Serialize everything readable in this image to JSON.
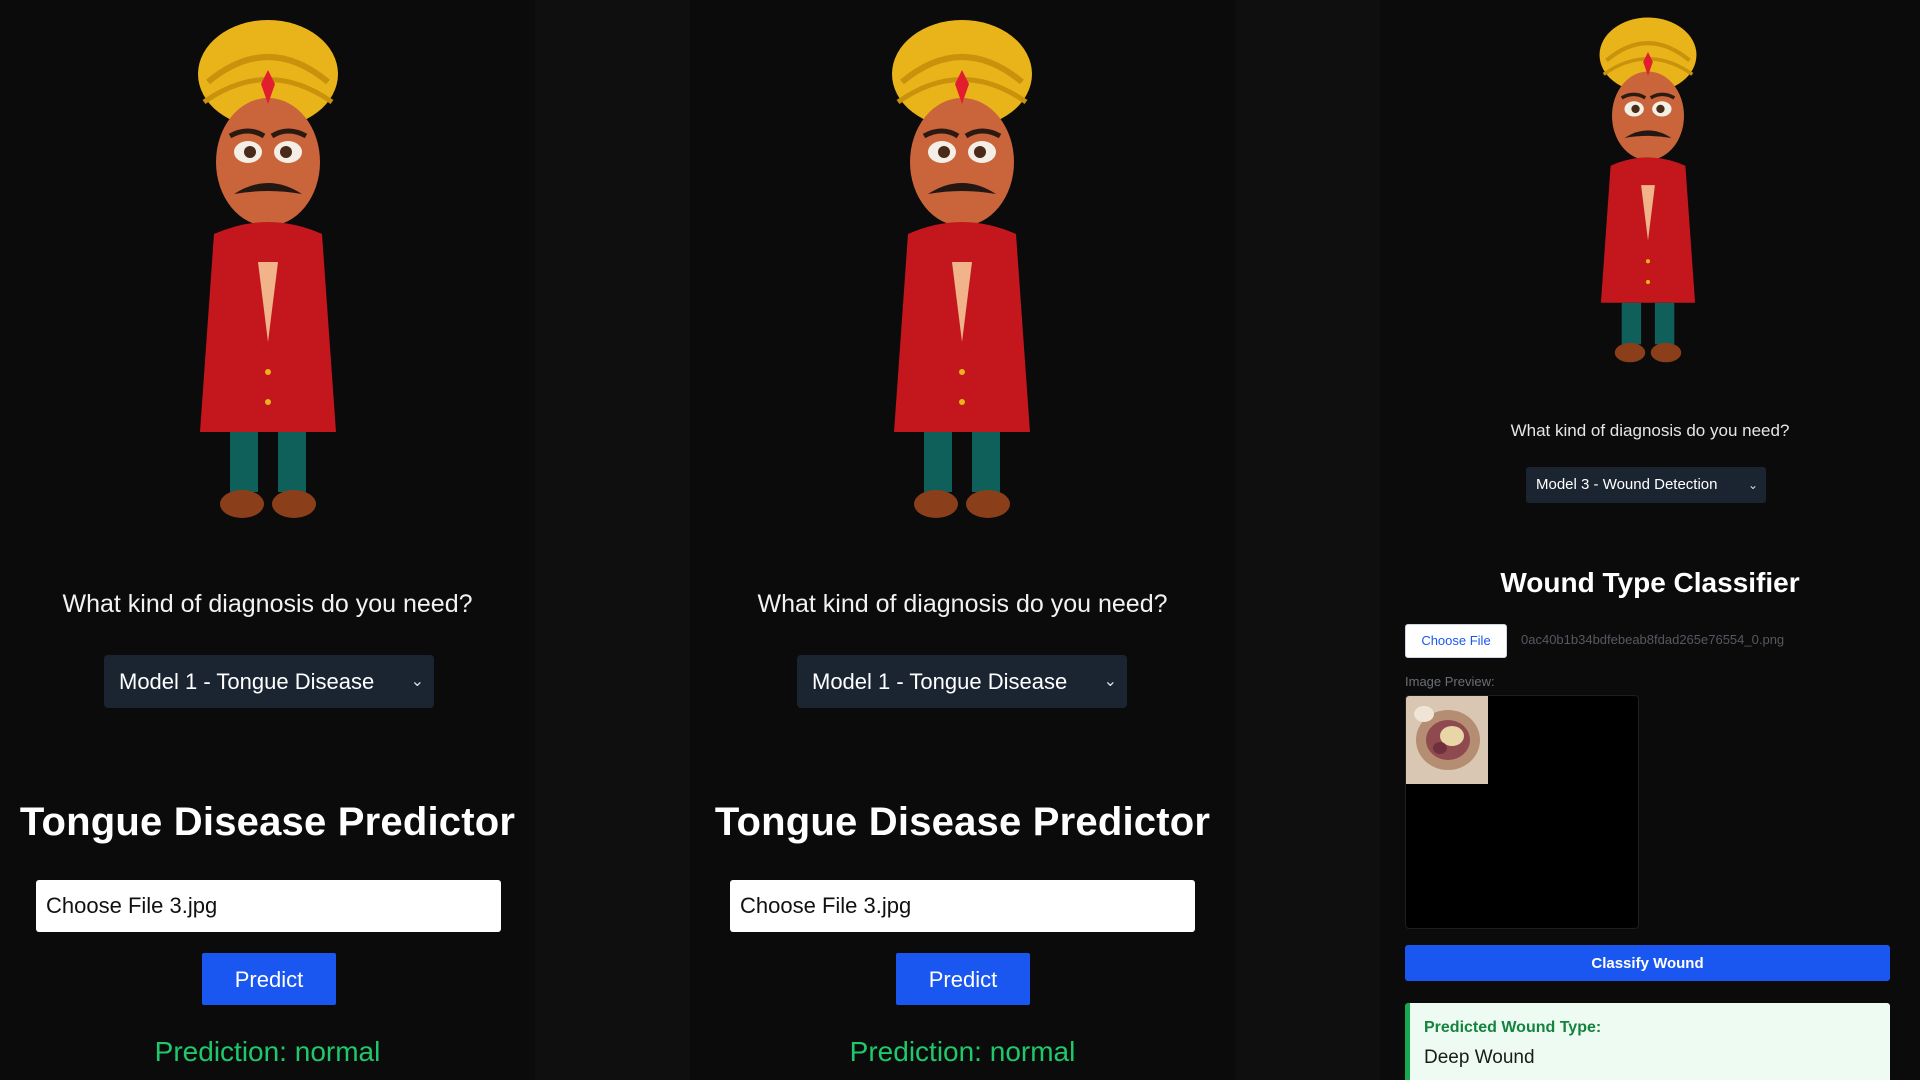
{
  "panels": [
    {
      "question": "What kind of diagnosis do you need?",
      "model_select": "Model 1 - Tongue Disease",
      "title": "Tongue Disease Predictor",
      "file_input": "Choose File 3.jpg",
      "predict_label": "Predict",
      "prediction": "Prediction: normal"
    },
    {
      "question": "What kind of diagnosis do you need?",
      "model_select": "Model 1 - Tongue Disease",
      "title": "Tongue Disease Predictor",
      "file_input": "Choose File 3.jpg",
      "predict_label": "Predict",
      "prediction": "Prediction: normal"
    }
  ],
  "wound_panel": {
    "question": "What kind of diagnosis do you need?",
    "model_select": "Model 3 - Wound Detection",
    "title": "Wound Type Classifier",
    "choose_file_label": "Choose File",
    "file_name": "0ac40b1b34bdfebeab8fdad265e76554_0.png",
    "preview_label": "Image Preview:",
    "classify_label": "Classify Wound",
    "result_heading": "Predicted Wound Type:",
    "result_value": "Deep Wound"
  },
  "icons": {
    "dropdown": "chevron-down-icon",
    "mascot": "mascot-character"
  },
  "colors": {
    "background": "#0b0b0c",
    "primary_button": "#1a56f0",
    "prediction_text": "#1fc86a",
    "select_background": "#1b2431",
    "result_card_background": "#eefbf3",
    "result_card_accent": "#19a84f"
  }
}
